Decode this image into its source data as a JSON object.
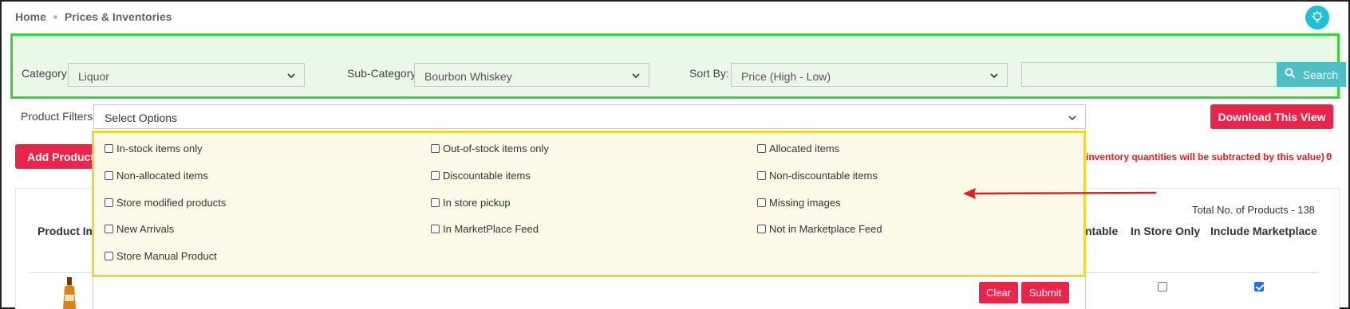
{
  "breadcrumb": {
    "home": "Home",
    "current": "Prices & Inventories"
  },
  "filters": {
    "category_label": "Category:",
    "category_value": "Liquor",
    "subcategory_label": "Sub-Category:",
    "subcategory_value": "Bourbon Whiskey",
    "sort_label": "Sort By:",
    "sort_value": "Price (High - Low)",
    "search_value": "",
    "search_label": "Search"
  },
  "product_filters": {
    "label": "Product Filters:",
    "placeholder": "Select Options",
    "options": [
      {
        "label": "In-stock items only",
        "checked": false
      },
      {
        "label": "Out-of-stock items only",
        "checked": false
      },
      {
        "label": "Allocated items",
        "checked": false
      },
      {
        "label": "Non-allocated items",
        "checked": false
      },
      {
        "label": "Discountable items",
        "checked": false
      },
      {
        "label": "Non-discountable items",
        "checked": false
      },
      {
        "label": "Store modified products",
        "checked": false
      },
      {
        "label": "In store pickup",
        "checked": false
      },
      {
        "label": "Missing images",
        "checked": false
      },
      {
        "label": "New Arrivals",
        "checked": false
      },
      {
        "label": "In MarketPlace Feed",
        "checked": false
      },
      {
        "label": "Not in Marketplace Feed",
        "checked": false
      },
      {
        "label": "Store Manual Product",
        "checked": false
      }
    ],
    "clear_label": "Clear",
    "submit_label": "Submit"
  },
  "actions": {
    "download_label": "Download This View",
    "add_products_label": "Add Products"
  },
  "note": {
    "text": "inventory quantities will be subtracted by this value) :",
    "value": "0"
  },
  "table": {
    "total_text": "Total No. of Products - 138",
    "headers": {
      "image": "Product Im",
      "discountable": "ntable",
      "in_store_only": "In Store Only",
      "include_marketplace": "Include Marketplace"
    },
    "first_row": {
      "in_store_only": false,
      "include_marketplace": true
    }
  },
  "colors": {
    "accent_red": "#e8264c",
    "search_teal": "#4ebfc4",
    "green_highlight": "#37d437",
    "yellow_highlight": "#f0d636",
    "arrow_red": "#e02020"
  }
}
